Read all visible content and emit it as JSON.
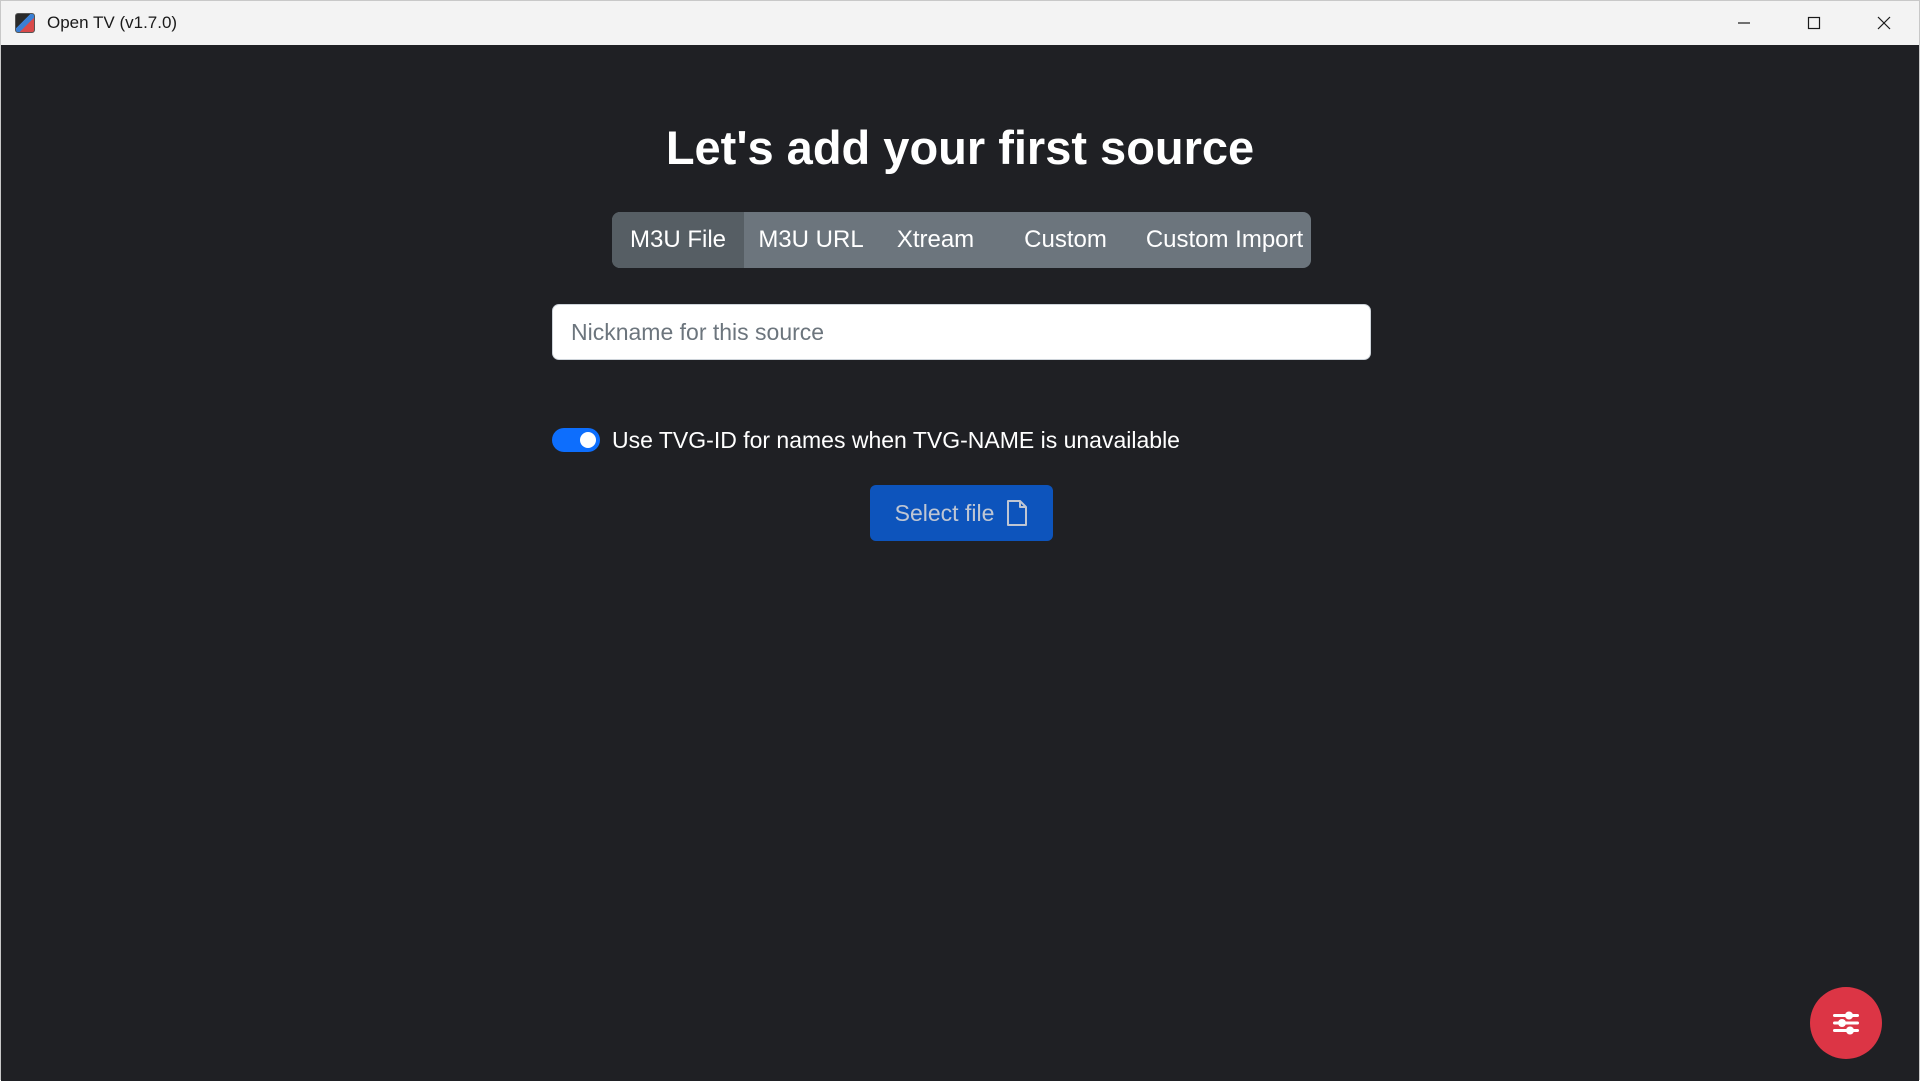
{
  "window": {
    "title": "Open TV (v1.7.0)",
    "controls": [
      "minimize-icon",
      "maximize-icon",
      "close-icon"
    ]
  },
  "main": {
    "heading": "Let's add your first source",
    "tabs": [
      {
        "label": "M3U File",
        "active": true
      },
      {
        "label": "M3U URL",
        "active": false
      },
      {
        "label": "Xtream",
        "active": false
      },
      {
        "label": "Custom",
        "active": false
      },
      {
        "label": "Custom Import",
        "active": false
      }
    ],
    "nickname": {
      "value": "",
      "placeholder": "Nickname for this source"
    },
    "toggle": {
      "label": "Use TVG-ID for names when TVG-NAME is unavailable",
      "checked": true
    },
    "select_button": {
      "label": "Select file",
      "icon": "file-icon"
    },
    "fab": {
      "icon": "settings-icon"
    }
  },
  "colors": {
    "background": "#1f2024",
    "tabs_bg": "#6c757d",
    "tab_active": "#565e64",
    "primary": "#0d6efd",
    "danger": "#dc3545"
  }
}
